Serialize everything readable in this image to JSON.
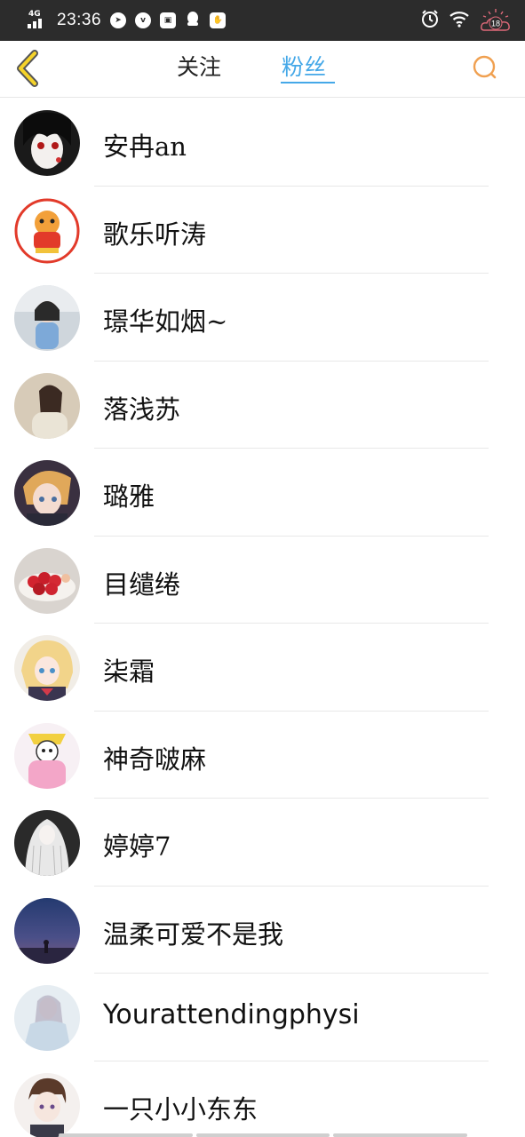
{
  "status_bar": {
    "network": "4G",
    "time": "23:36",
    "battery_level": "18",
    "left_icons": [
      "compass-icon",
      "vivo-icon",
      "image-icon",
      "qq-icon",
      "hand-icon"
    ],
    "right_icons": [
      "alarm-icon",
      "wifi-icon",
      "battery-icon"
    ]
  },
  "header": {
    "back_icon": "chevron-left-icon",
    "tabs": [
      {
        "label": "关注",
        "active": false
      },
      {
        "label": "粉丝",
        "active": true
      }
    ],
    "search_icon": "search-icon",
    "accent_color": "#45a8e8",
    "icon_color": "#f0a050"
  },
  "fans": [
    {
      "name": "安冉an",
      "avatar": "avatar-anime-girl-dark"
    },
    {
      "name": "歌乐听涛",
      "avatar": "avatar-cartoon-tiger"
    },
    {
      "name": "璟华如烟~",
      "avatar": "avatar-little-girl"
    },
    {
      "name": "落浅苏",
      "avatar": "avatar-ancient-costume-girl"
    },
    {
      "name": "璐雅",
      "avatar": "avatar-anime-boy-blond"
    },
    {
      "name": "目缱绻",
      "avatar": "avatar-strawberries"
    },
    {
      "name": "柒霜",
      "avatar": "avatar-anime-girl-blonde"
    },
    {
      "name": "神奇啵麻",
      "avatar": "avatar-cartoon-pink"
    },
    {
      "name": "婷婷7",
      "avatar": "avatar-white-hair-girl"
    },
    {
      "name": "温柔可爱不是我",
      "avatar": "avatar-night-sky"
    },
    {
      "name": "Yourattendingphysi",
      "avatar": "avatar-watercolor-girl"
    },
    {
      "name": "一只小小东东",
      "avatar": "avatar-anime-boy-brown"
    }
  ]
}
